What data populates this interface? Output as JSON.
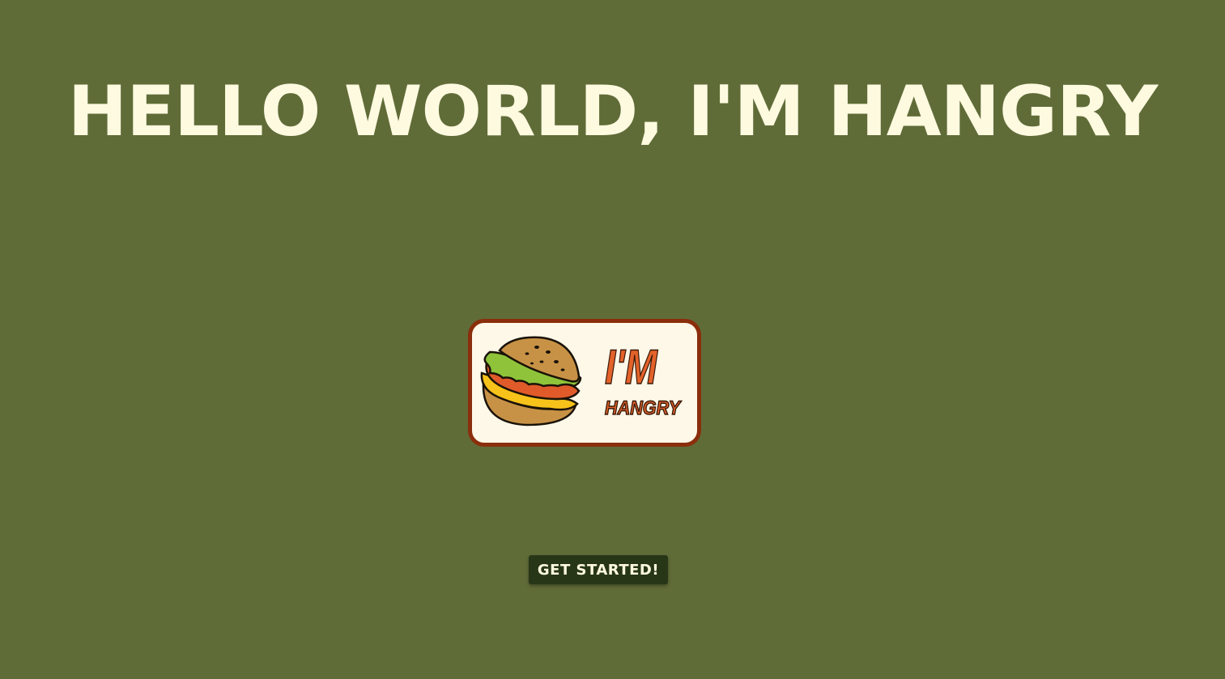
{
  "hero": {
    "title": "Hello World, I'm Hangry"
  },
  "logo": {
    "icon": "burger-icon",
    "line1": "I'M",
    "line2": "HANGRY"
  },
  "cta": {
    "label": "GET STARTED!"
  },
  "colors": {
    "background": "#606c38",
    "title": "#fefae0",
    "button_bg": "#283618",
    "button_text": "#fefae0",
    "logo_border": "#8a2e0c",
    "logo_fill": "#fdf8e8",
    "logo_text": "#e3622a"
  }
}
